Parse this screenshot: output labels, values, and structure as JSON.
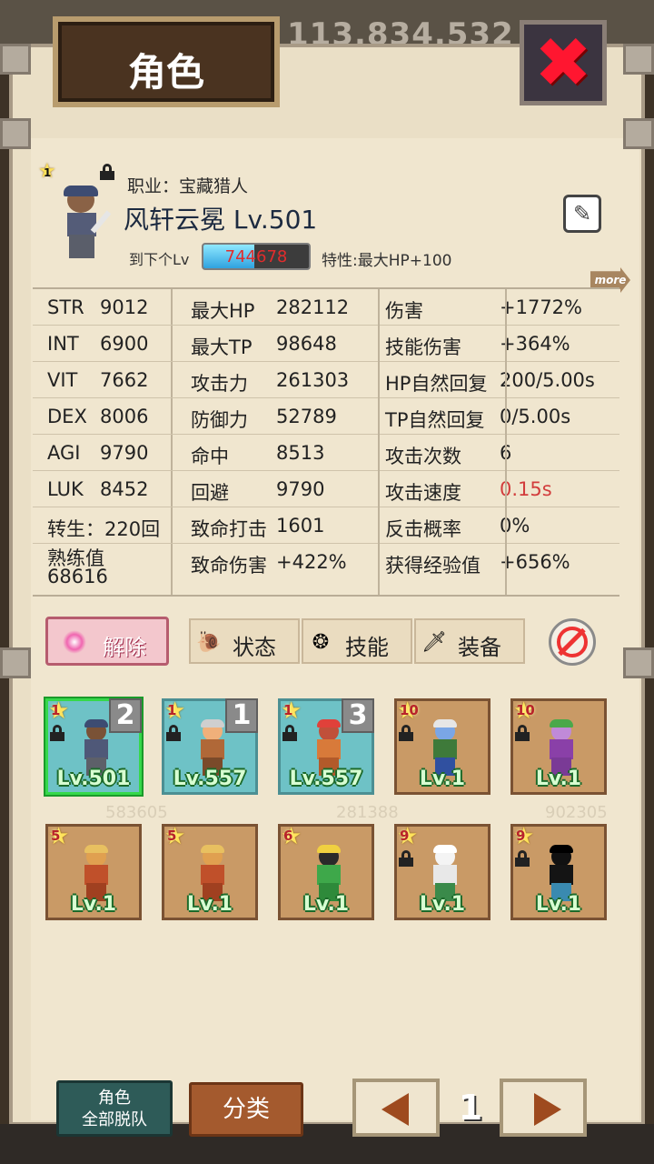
{
  "header": {
    "title": "角色",
    "close_icon": "close-x-icon",
    "bg_number": "113,834,532"
  },
  "character": {
    "star_level": "1",
    "job": "职业：宝藏猎人",
    "name": "风轩云冕 Lv.501",
    "next_level_label": "到下个Lv",
    "exp_value": "744678",
    "exp_fill_fraction": 0.48,
    "trait": "特性:最大HP+100",
    "more_label": "more"
  },
  "stats": {
    "rows": [
      {
        "c1": "STR",
        "v1": "9012",
        "c2": "最大HP",
        "v2": "282112",
        "c3": "伤害",
        "v3": "+1772%"
      },
      {
        "c1": "INT",
        "v1": "6900",
        "c2": "最大TP",
        "v2": "98648",
        "c3": "技能伤害",
        "v3": "+364%"
      },
      {
        "c1": "VIT",
        "v1": "7662",
        "c2": "攻击力",
        "v2": "261303",
        "c3": "HP自然回复",
        "v3": "200/5.00s"
      },
      {
        "c1": "DEX",
        "v1": "8006",
        "c2": "防御力",
        "v2": "52789",
        "c3": "TP自然回复",
        "v3": "0/5.00s"
      },
      {
        "c1": "AGI",
        "v1": "9790",
        "c2": "命中",
        "v2": "8513",
        "c3": "攻击次数",
        "v3": "6"
      },
      {
        "c1": "LUK",
        "v1": "8452",
        "c2": "回避",
        "v2": "9790",
        "c3": "攻击速度",
        "v3": "0.15s"
      },
      {
        "c1": "转生：220回",
        "v1": "",
        "c2": "致命打击",
        "v2": "1601",
        "c3": "反击概率",
        "v3": "0%"
      },
      {
        "c1": "熟练值",
        "v1": "68616",
        "c2": "致命伤害",
        "v2": "+422%",
        "c3": "获得经验值",
        "v3": "+656%"
      }
    ]
  },
  "actions": {
    "release": "解除",
    "tabs": [
      {
        "label": "状态",
        "icon": "status-icon"
      },
      {
        "label": "技能",
        "icon": "skill-icon"
      },
      {
        "label": "装备",
        "icon": "sword-icon"
      }
    ],
    "cancel_icon": "no-entry-icon"
  },
  "roster": [
    {
      "stars": "1",
      "level": "Lv.501",
      "order": "2",
      "locked": true,
      "teal": true,
      "selected": true
    },
    {
      "stars": "1",
      "level": "Lv.557",
      "order": "1",
      "locked": true,
      "teal": true,
      "selected": false
    },
    {
      "stars": "1",
      "level": "Lv.557",
      "order": "3",
      "locked": true,
      "teal": true,
      "selected": false
    },
    {
      "stars": "10",
      "level": "Lv.1",
      "order": "",
      "locked": true,
      "teal": false,
      "selected": false
    },
    {
      "stars": "10",
      "level": "Lv.1",
      "order": "",
      "locked": true,
      "teal": false,
      "selected": false
    },
    {
      "stars": "5",
      "level": "Lv.1",
      "order": "",
      "locked": false,
      "teal": false,
      "selected": false
    },
    {
      "stars": "5",
      "level": "Lv.1",
      "order": "",
      "locked": false,
      "teal": false,
      "selected": false
    },
    {
      "stars": "6",
      "level": "Lv.1",
      "order": "",
      "locked": false,
      "teal": false,
      "selected": false
    },
    {
      "stars": "9",
      "level": "Lv.1",
      "order": "",
      "locked": true,
      "teal": false,
      "selected": false
    },
    {
      "stars": "9",
      "level": "Lv.1",
      "order": "",
      "locked": true,
      "teal": false,
      "selected": false
    }
  ],
  "bottom": {
    "disband_line1": "角色",
    "disband_line2": "全部脱队",
    "sort": "分类",
    "page": "1",
    "prev_icon": "arrow-left-icon",
    "next_icon": "arrow-right-icon"
  },
  "colors": {
    "accent_red": "#d23c3c",
    "level_green": "#d8ffd2",
    "selected_border": "#36d84a"
  }
}
